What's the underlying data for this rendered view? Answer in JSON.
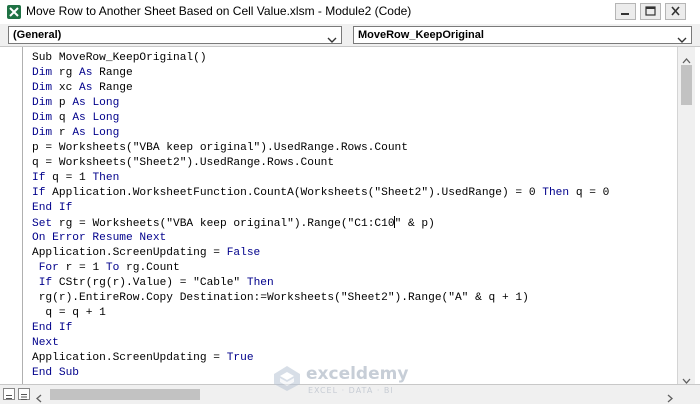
{
  "window": {
    "title": "Move Row to Another Sheet Based on Cell Value.xlsm - Module2 (Code)"
  },
  "toolbar": {
    "object_dropdown": "(General)",
    "procedure_dropdown": "MoveRow_KeepOriginal"
  },
  "code_lines": [
    [
      {
        "t": "Sub MoveRow_KeepOriginal()",
        "k": 0
      }
    ],
    [
      {
        "t": "Dim",
        "k": 1
      },
      {
        "t": " rg ",
        "k": 0
      },
      {
        "t": "As",
        "k": 1
      },
      {
        "t": " Range",
        "k": 0
      }
    ],
    [
      {
        "t": "Dim",
        "k": 1
      },
      {
        "t": " xc ",
        "k": 0
      },
      {
        "t": "As",
        "k": 1
      },
      {
        "t": " Range",
        "k": 0
      }
    ],
    [
      {
        "t": "Dim",
        "k": 1
      },
      {
        "t": " p ",
        "k": 0
      },
      {
        "t": "As",
        "k": 1
      },
      {
        "t": " ",
        "k": 0
      },
      {
        "t": "Long",
        "k": 1
      }
    ],
    [
      {
        "t": "Dim",
        "k": 1
      },
      {
        "t": " q ",
        "k": 0
      },
      {
        "t": "As",
        "k": 1
      },
      {
        "t": " ",
        "k": 0
      },
      {
        "t": "Long",
        "k": 1
      }
    ],
    [
      {
        "t": "Dim",
        "k": 1
      },
      {
        "t": " r ",
        "k": 0
      },
      {
        "t": "As",
        "k": 1
      },
      {
        "t": " ",
        "k": 0
      },
      {
        "t": "Long",
        "k": 1
      }
    ],
    [
      {
        "t": "p = Worksheets(\"VBA keep original\").UsedRange.Rows.Count",
        "k": 0
      }
    ],
    [
      {
        "t": "q = Worksheets(\"Sheet2\").UsedRange.Rows.Count",
        "k": 0
      }
    ],
    [
      {
        "t": "If",
        "k": 1
      },
      {
        "t": " q = 1 ",
        "k": 0
      },
      {
        "t": "Then",
        "k": 1
      }
    ],
    [
      {
        "t": "If",
        "k": 1
      },
      {
        "t": " Application.WorksheetFunction.CountA(Worksheets(\"Sheet2\").UsedRange) = 0 ",
        "k": 0
      },
      {
        "t": "Then",
        "k": 1
      },
      {
        "t": " q = 0",
        "k": 0
      }
    ],
    [
      {
        "t": "End If",
        "k": 1
      }
    ],
    [
      {
        "t": "Set",
        "k": 1
      },
      {
        "t": " rg = Worksheets(\"VBA keep original\").Range(\"C1:C10",
        "k": 0
      },
      {
        "t": "",
        "k": 2
      },
      {
        "t": "\" & p)",
        "k": 0
      }
    ],
    [
      {
        "t": "On Error Resume Next",
        "k": 1
      }
    ],
    [
      {
        "t": "Application.ScreenUpdating = ",
        "k": 0
      },
      {
        "t": "False",
        "k": 1
      }
    ],
    [
      {
        "t": " ",
        "k": 0
      },
      {
        "t": "For",
        "k": 1
      },
      {
        "t": " r = 1 ",
        "k": 0
      },
      {
        "t": "To",
        "k": 1
      },
      {
        "t": " rg.Count",
        "k": 0
      }
    ],
    [
      {
        "t": " ",
        "k": 0
      },
      {
        "t": "If",
        "k": 1
      },
      {
        "t": " CStr(rg(r).Value) = \"Cable\" ",
        "k": 0
      },
      {
        "t": "Then",
        "k": 1
      }
    ],
    [
      {
        "t": " rg(r).EntireRow.Copy Destination:=Worksheets(\"Sheet2\").Range(\"A\" & q + 1)",
        "k": 0
      }
    ],
    [
      {
        "t": "  q = q + 1",
        "k": 0
      }
    ],
    [
      {
        "t": "End If",
        "k": 1
      }
    ],
    [
      {
        "t": "Next",
        "k": 1
      }
    ],
    [
      {
        "t": "Application.ScreenUpdating = ",
        "k": 0
      },
      {
        "t": "True",
        "k": 1
      }
    ],
    [
      {
        "t": "End Sub",
        "k": 1
      }
    ]
  ],
  "watermark": {
    "name": "exceldemy",
    "tagline": "EXCEL · DATA · BI"
  },
  "colors": {
    "keyword": "#00008b",
    "text": "#000000",
    "titlebar_bg": "#ffffff",
    "toolbar_bg": "#f0f0f0"
  },
  "icons": {
    "app": "excel-icon",
    "minimize": "minimize-icon",
    "maximize": "maximize-icon",
    "close": "close-icon",
    "dropdown": "chevron-down-icon",
    "watermark": "exceldemy-logo"
  }
}
